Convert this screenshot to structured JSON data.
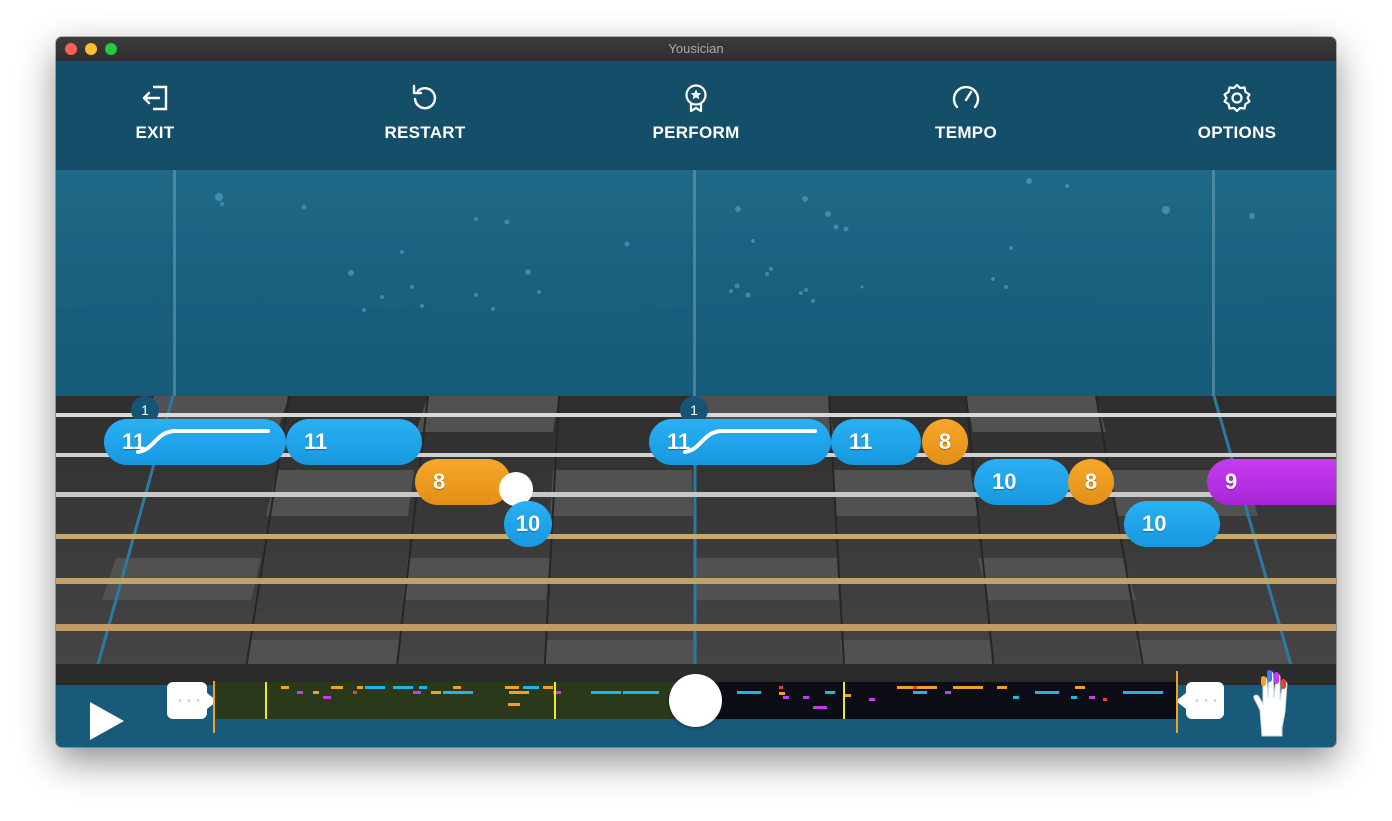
{
  "window": {
    "title": "Yousician"
  },
  "toolbar": {
    "exit_label": "EXIT",
    "restart_label": "RESTART",
    "perform_label": "PERFORM",
    "tempo_label": "TEMPO",
    "options_label": "OPTIONS"
  },
  "notes": {
    "n1": "11",
    "n2": "11",
    "n3": "8",
    "n4": "10",
    "n5": "11",
    "n6": "11",
    "n7": "8",
    "n8": "10",
    "n9": "8",
    "n10": "10",
    "n11": "9",
    "badge1": "1",
    "badge2": "1"
  },
  "colors": {
    "blue_note": "#1fa5ee",
    "orange_note": "#f0a024",
    "purple_note": "#bd34e8",
    "played": "#29391a"
  },
  "icons": [
    "exit-icon",
    "restart-icon",
    "perform-icon",
    "tempo-icon",
    "options-icon",
    "play-icon",
    "hand-icon"
  ],
  "progress": {
    "fraction": 0.5
  }
}
